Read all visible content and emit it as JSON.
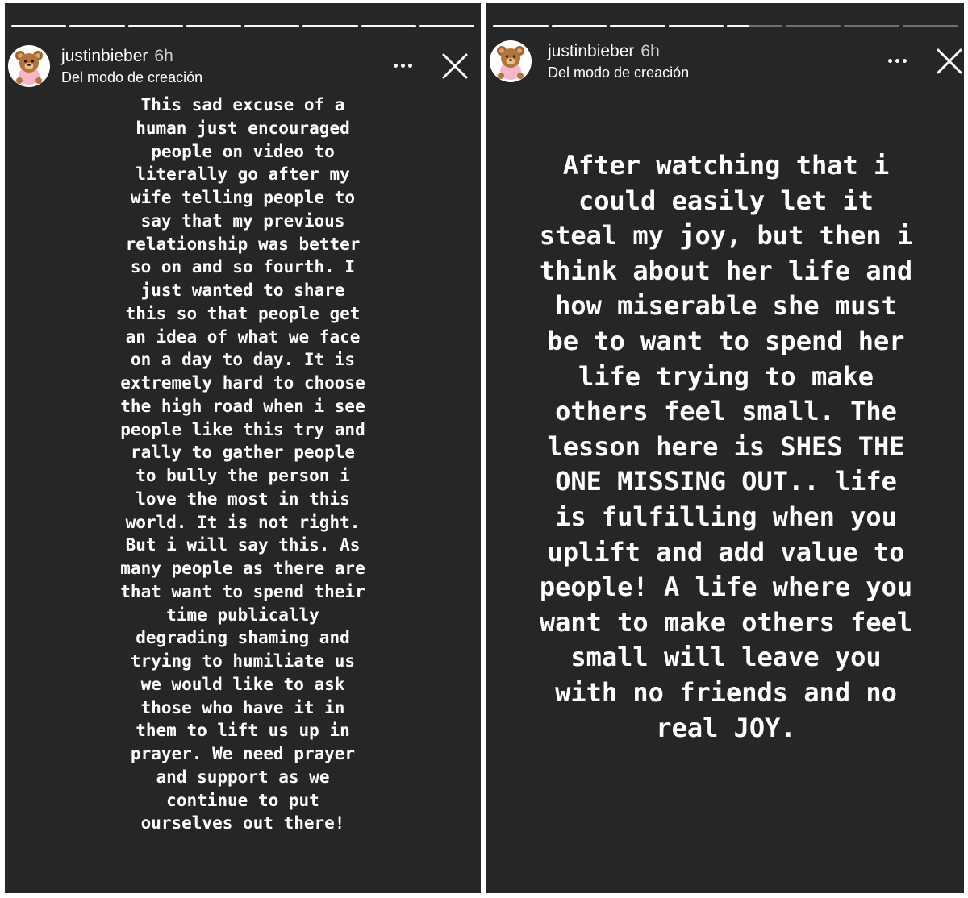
{
  "stories": [
    {
      "username": "justinbieber",
      "time": "6h",
      "subtitle": "Del modo de creación",
      "avatar_icon": "teddy-bear-icon",
      "more_icon": "more-horizontal-icon",
      "close_icon": "close-icon",
      "progress_fill": [
        1,
        1,
        1,
        1,
        1,
        1,
        1,
        1
      ],
      "caption": "This sad excuse of a\nhuman just encouraged\npeople on video to\nliterally go after my\nwife telling people to\nsay that my previous\nrelationship was better\nso on and so fourth. I\njust wanted to share\nthis so that people get\nan idea of what we face\non a day to day. It is\nextremely hard to choose\nthe high road when i see\npeople like this try and\nrally to gather people\nto bully the person i\nlove the most in this\nworld. It is not right.\nBut i will say this. As\nmany people as there are\nthat want to spend their\ntime publically\ndegrading shaming and\ntrying to humiliate us\nwe would like to ask\nthose who have it in\nthem to lift us up in\nprayer. We need prayer\nand support as we\ncontinue to put\nourselves out there!"
    },
    {
      "username": "justinbieber",
      "time": "6h",
      "subtitle": "Del modo de creación",
      "avatar_icon": "teddy-bear-icon",
      "more_icon": "more-horizontal-icon",
      "close_icon": "close-icon",
      "progress_fill": [
        1,
        1,
        1,
        1,
        0.4,
        0,
        0,
        0
      ],
      "caption": "After watching that i\ncould easily let it\nsteal my joy, but then i\nthink about her life and\nhow miserable she must\nbe to want to spend her\nlife trying to make\nothers feel small. The\nlesson here is SHES THE\nONE MISSING OUT.. life\nis fulfilling when you\nuplift and add value to\npeople! A life where you\nwant to make others feel\nsmall will leave you\nwith no friends and no\nreal JOY."
    }
  ]
}
